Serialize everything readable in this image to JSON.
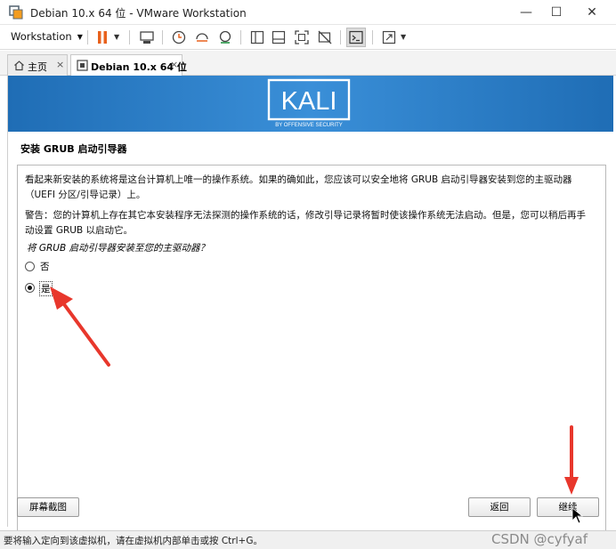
{
  "window": {
    "title": "Debian 10.x 64 位 - VMware Workstation",
    "minimize": "—",
    "maximize": "☐",
    "close": "✕"
  },
  "toolbar": {
    "workstation_label": "Workstation",
    "pause_color": "#e8611c"
  },
  "tabs": [
    {
      "label": "主页",
      "icon": "home-icon"
    },
    {
      "label": "Debian 10.x 64 位",
      "icon": "vm-icon"
    }
  ],
  "tab_close": "×",
  "banner": {
    "logo_text": "KALI",
    "logo_sub": "BY OFFENSIVE SECURITY",
    "color": "#2a7fcf"
  },
  "installer": {
    "title": "安装 GRUB 启动引导器",
    "paragraph1": "看起来新安装的系统将是这台计算机上唯一的操作系统。如果的确如此，您应该可以安全地将 GRUB 启动引导器安装到您的主驱动器（UEFI 分区/引导记录）上。",
    "paragraph2": "警告：您的计算机上存在其它本安装程序无法探测的操作系统的话，修改引导记录将暂时使该操作系统无法启动。但是，您可以稍后再手动设置 GRUB 以启动它。",
    "question": "将 GRUB 启动引导器安装至您的主驱动器？",
    "options": [
      {
        "label": "否",
        "selected": false
      },
      {
        "label": "是",
        "selected": true
      }
    ],
    "screenshot_button": "屏幕截图",
    "back_button": "返回",
    "continue_button": "继续"
  },
  "statusbar": {
    "message": "要将输入定向到该虚拟机，请在虚拟机内部单击或按 Ctrl+G。",
    "watermark": "CSDN @cyfyaf"
  },
  "annotations": {
    "arrow_color": "#e8372c"
  }
}
